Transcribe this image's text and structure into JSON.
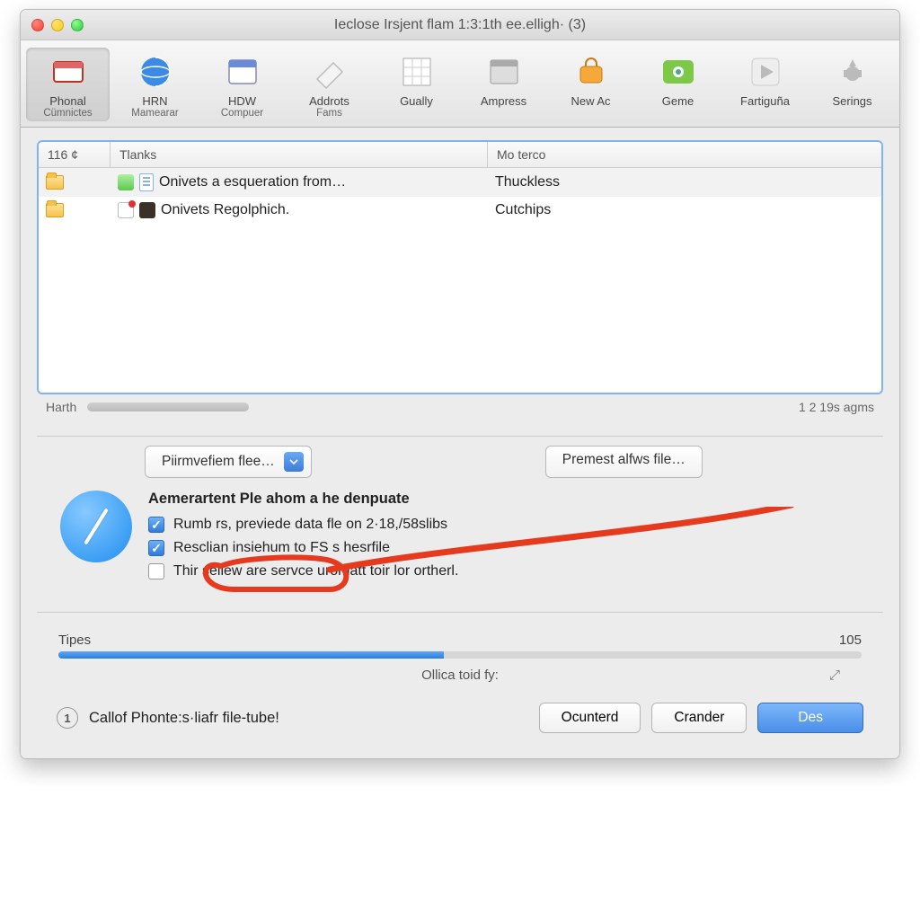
{
  "window": {
    "title": "Ieclose Irsjent flam 1:3:1th ee.elligh· (3)"
  },
  "toolbar": [
    {
      "label1": "Phonal",
      "label2": "Cümnictes",
      "icon": "window-icon",
      "selected": true
    },
    {
      "label1": "HRN",
      "label2": "Mamearar",
      "icon": "globe-icon"
    },
    {
      "label1": "HDW",
      "label2": "Compuer",
      "icon": "calendar-icon"
    },
    {
      "label1": "Addrots",
      "label2": "Fams",
      "icon": "eraser-icon"
    },
    {
      "label1": "Gually",
      "label2": "",
      "icon": "grid-icon"
    },
    {
      "label1": "Ampress",
      "label2": "",
      "icon": "panel-icon"
    },
    {
      "label1": "New Aс",
      "label2": "",
      "icon": "bag-icon"
    },
    {
      "label1": "Geme",
      "label2": "",
      "icon": "eye-icon"
    },
    {
      "label1": "Fartiguña",
      "label2": "",
      "icon": "play-icon"
    },
    {
      "label1": "Serings",
      "label2": "",
      "icon": "gear-icon"
    }
  ],
  "list": {
    "head": {
      "c1": "116 ¢",
      "c2": "Tlanks",
      "c3": "Mo terco"
    },
    "rows": [
      {
        "title": "Onivets a esqueration from…",
        "sub": "Thuckless"
      },
      {
        "title": "Onivets Regolphich.",
        "sub": "Cutchips"
      }
    ],
    "footer_left": "Harth",
    "footer_right": "1 2 19s agms"
  },
  "midButtons": {
    "left": "Piirmvefiem flee…",
    "right": "Premest alfws file…"
  },
  "options": {
    "heading": "Aemerartent Ple ahom a he denpuate",
    "items": [
      {
        "checked": true,
        "text": "Rumb rs, previede data fle on 2·18,/58slibs"
      },
      {
        "checked": true,
        "text": "Resclian insiehum to FS s hesrfile"
      },
      {
        "checked": false,
        "text": "Thir sellew are servce uromatt toir lor ortherl."
      }
    ]
  },
  "progress": {
    "label": "Tipes",
    "value_text": "105",
    "percent": 48
  },
  "caption": "Ollica toid fy:",
  "bottom": {
    "badge": "1",
    "text": "Callof Phonte:s·liafr file-tube!",
    "btn1": "Ocunterd",
    "btn2": "Crander",
    "btn3": "Des"
  }
}
